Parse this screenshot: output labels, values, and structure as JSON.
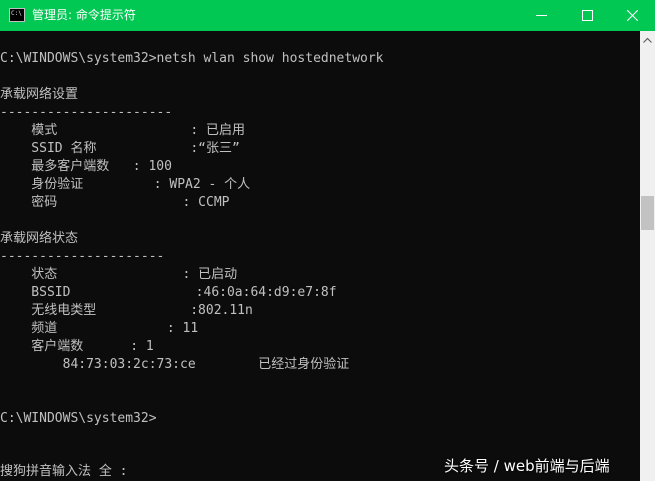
{
  "window": {
    "title": "管理员: 命令提示符",
    "colors": {
      "titlebar": "#00c853",
      "background": "#0c0c0c",
      "text": "#c0c0c0"
    }
  },
  "console": {
    "lines": [
      "C:\\WINDOWS\\system32>netsh wlan show hostednetwork",
      "承载网络设置",
      "----------------------",
      "    模式                 : 已启用",
      "    SSID 名称            :“张三”",
      "    最多客户端数   : 100",
      "    身份验证         : WPA2 - 个人",
      "    密码                : CCMP",
      "承载网络状态",
      "---------------------",
      "    状态                : 已启动",
      "    BSSID                :46:0a:64:d9:e7:8f",
      "    无线电类型            :802.11n",
      "    频道              : 11",
      "    客户端数      : 1",
      "        84:73:03:2c:73:ce        已经过身份验证",
      "C:\\WINDOWS\\system32>",
      "搜狗拼音输入法 全 :"
    ]
  },
  "watermark": "头条号 / web前端与后端"
}
